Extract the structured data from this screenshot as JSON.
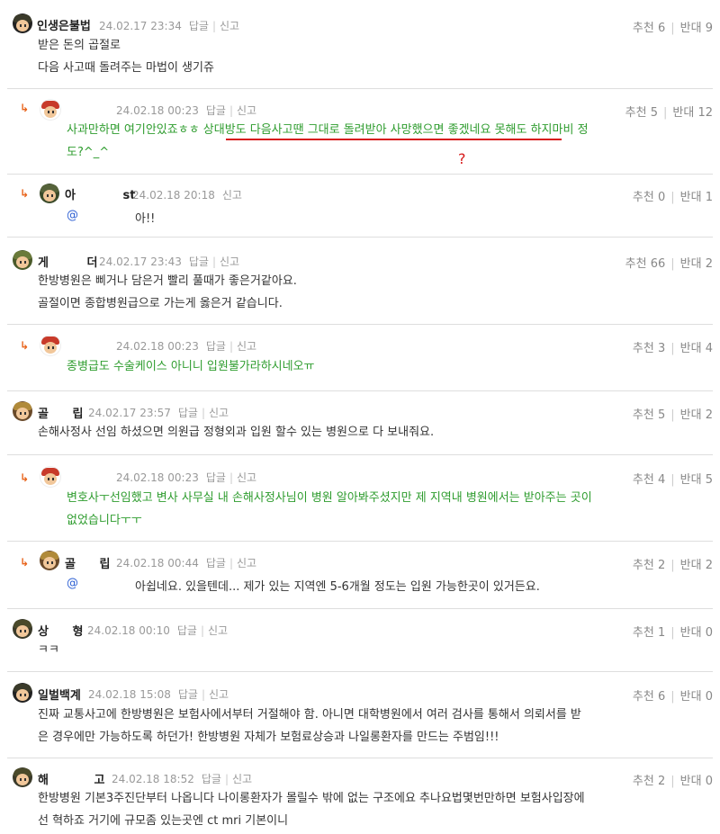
{
  "comments": [
    {
      "nick": "인생은불법",
      "date": "24.02.17 23:34",
      "reply": "답글",
      "report": "신고",
      "up_label": "추천",
      "up": "6",
      "down_label": "반대",
      "down": "9",
      "lines": [
        "받은 돈의 곱절로",
        "다음 사고때 돌려주는 마법이 생기쥬"
      ]
    },
    {
      "nick": "",
      "date": "24.02.18 00:23",
      "reply": "답글",
      "report": "신고",
      "up_label": "추천",
      "up": "5",
      "down_label": "반대",
      "down": "12",
      "lines": [
        "사과만하면 여기안있죠ㅎㅎ 상대방도 다음사고땐 그대로 돌려받아 사망했으면 좋겠네요 못해도 하지마비 정",
        "도?^_^"
      ],
      "annotation_mark": "?"
    },
    {
      "nick": "아 st",
      "date": "24.02.18 20:18",
      "reply": "",
      "report": "신고",
      "up_label": "추천",
      "up": "0",
      "down_label": "반대",
      "down": "1",
      "mention": "@",
      "text": "아!!"
    },
    {
      "nick": "게 더",
      "date": "24.02.17 23:43",
      "reply": "답글",
      "report": "신고",
      "up_label": "추천",
      "up": "66",
      "down_label": "반대",
      "down": "2",
      "lines": [
        "한방병원은 삐거나 담은거 빨리 풀때가 좋은거같아요.",
        "골절이면 종합병원급으로 가는게 옳은거 같습니다."
      ]
    },
    {
      "nick": "",
      "date": "24.02.18 00:23",
      "reply": "답글",
      "report": "신고",
      "up_label": "추천",
      "up": "3",
      "down_label": "반대",
      "down": "4",
      "lines": [
        "종병급도 수술케이스 아니니 입원불가라하시네오ㅠ"
      ]
    },
    {
      "nick": "골 립",
      "date": "24.02.17 23:57",
      "reply": "답글",
      "report": "신고",
      "up_label": "추천",
      "up": "5",
      "down_label": "반대",
      "down": "2",
      "lines": [
        "손해사정사 선임 하셨으면 의원급 정형외과 입원 할수 있는 병원으로 다 보내줘요."
      ]
    },
    {
      "nick": "",
      "date": "24.02.18 00:23",
      "reply": "답글",
      "report": "신고",
      "up_label": "추천",
      "up": "4",
      "down_label": "반대",
      "down": "5",
      "lines": [
        "변호사ㅜ선임했고 변사 사무실 내 손해사정사님이 병원 알아봐주셨지만 제 지역내 병원에서는 받아주는 곳이",
        "없었습니다ㅜㅜ"
      ]
    },
    {
      "nick": "골 립",
      "date": "24.02.18 00:44",
      "reply": "답글",
      "report": "신고",
      "up_label": "추천",
      "up": "2",
      "down_label": "반대",
      "down": "2",
      "mention": "@",
      "text": "아쉽네요. 있을텐데... 제가 있는 지역엔 5-6개월 정도는 입원 가능한곳이 있거든요."
    },
    {
      "nick": "상 형",
      "date": "24.02.18 00:10",
      "reply": "답글",
      "report": "신고",
      "up_label": "추천",
      "up": "1",
      "down_label": "반대",
      "down": "0",
      "lines": [
        "ㅋㅋ"
      ]
    },
    {
      "nick": "일벌백계",
      "date": "24.02.18 15:08",
      "reply": "답글",
      "report": "신고",
      "up_label": "추천",
      "up": "6",
      "down_label": "반대",
      "down": "0",
      "lines": [
        "진짜 교통사고에 한방병원은 보험사에서부터 거절해야 함. 아니면 대학병원에서 여러 검사를 통해서 의뢰서를 받",
        "은 경우에만 가능하도록 하던가! 한방병원 자체가 보험료상승과 나일롱환자를 만드는 주범임!!!"
      ]
    },
    {
      "nick": "해 고",
      "date": "24.02.18 18:52",
      "reply": "답글",
      "report": "신고",
      "up_label": "추천",
      "up": "2",
      "down_label": "반대",
      "down": "0",
      "lines": [
        "한방병원 기본3주진단부터 나옵니다 나이롱환자가 몰릴수 밖에 없는 구조에요 추나요법몇번만하면 보험사입장에",
        "선 혁하죠 거기에 규모좀 있는곳엔 ct mri 기본이니"
      ]
    }
  ],
  "colors": {
    "green": "#2e9c2e",
    "mention": "#2d5fd3",
    "annotation": "#d71a1a",
    "reply_arrow": "#e8641c"
  },
  "icons": {
    "reply": "reply-arrow-icon",
    "avatar": "avatar-icon"
  }
}
